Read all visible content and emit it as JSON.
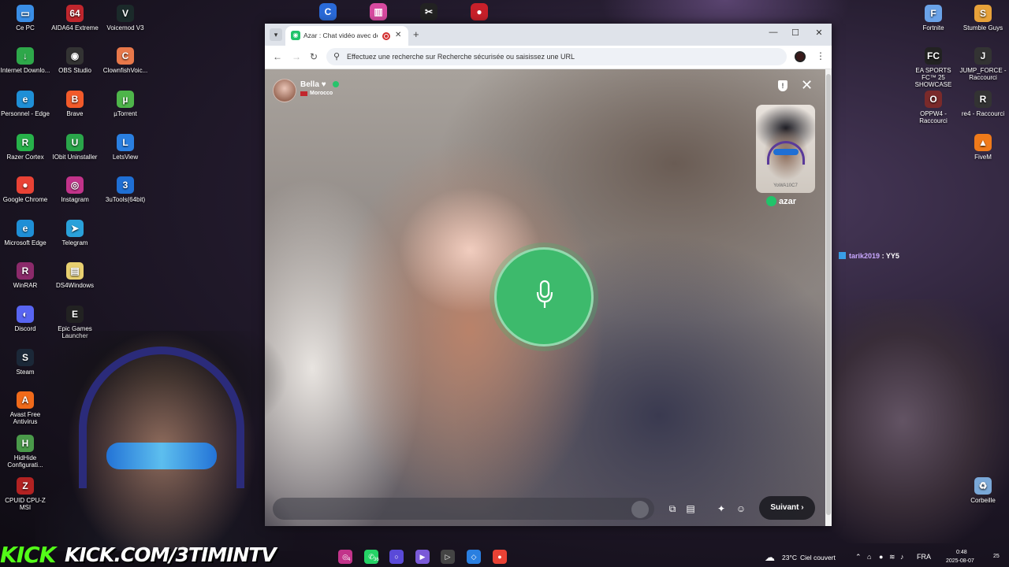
{
  "desktop_left": [
    {
      "label": "Ce PC",
      "icon": "computer-icon",
      "color": "#3a8ee6",
      "glyph": "▭"
    },
    {
      "label": "AIDA64 Extreme",
      "icon": "aida64-icon",
      "color": "#c0262d",
      "glyph": "64"
    },
    {
      "label": "Voicemod V3",
      "icon": "voicemod-icon",
      "color": "#1b2a2a",
      "glyph": "V"
    },
    {
      "label": "Internet Downlo...",
      "icon": "idm-icon",
      "color": "#2ea84a",
      "glyph": "↓"
    },
    {
      "label": "OBS Studio",
      "icon": "obs-icon",
      "color": "#333",
      "glyph": "◉"
    },
    {
      "label": "ClownfishVoic...",
      "icon": "clownfish-icon",
      "color": "#e8784a",
      "glyph": "C"
    },
    {
      "label": "Personnel - Edge",
      "icon": "edge-icon",
      "color": "#1f8fd6",
      "glyph": "e"
    },
    {
      "label": "Brave",
      "icon": "brave-icon",
      "color": "#f25a2a",
      "glyph": "B"
    },
    {
      "label": "µTorrent",
      "icon": "utorrent-icon",
      "color": "#4eb54a",
      "glyph": "µ"
    },
    {
      "label": "Razer Cortex",
      "icon": "razer-icon",
      "color": "#27b24a",
      "glyph": "R"
    },
    {
      "label": "IObit Uninstaller",
      "icon": "iobit-icon",
      "color": "#2aa64a",
      "glyph": "U"
    },
    {
      "label": "LetsView",
      "icon": "letsview-icon",
      "color": "#2a7fe0",
      "glyph": "L"
    },
    {
      "label": "Google Chrome",
      "icon": "chrome-icon",
      "color": "#e94235",
      "glyph": "●"
    },
    {
      "label": "Instagram",
      "icon": "instagram-icon",
      "color": "#c2338a",
      "glyph": "◎"
    },
    {
      "label": "3uTools(64bit)",
      "icon": "3utools-icon",
      "color": "#1f6fd4",
      "glyph": "3"
    },
    {
      "label": "Microsoft Edge",
      "icon": "edge-icon",
      "color": "#1f8fd6",
      "glyph": "e"
    },
    {
      "label": "Telegram",
      "icon": "telegram-icon",
      "color": "#2aa1da",
      "glyph": "➤"
    },
    {
      "label": "WinRAR",
      "icon": "winrar-icon",
      "color": "#8b2a6a",
      "glyph": "R"
    },
    {
      "label": "DS4Windows",
      "icon": "ds4windows-icon",
      "color": "#e8d070",
      "glyph": "▤"
    },
    {
      "label": "Discord",
      "icon": "discord-icon",
      "color": "#5865f2",
      "glyph": "◐"
    },
    {
      "label": "Epic Games Launcher",
      "icon": "epic-icon",
      "color": "#222",
      "glyph": "E"
    },
    {
      "label": "Steam",
      "icon": "steam-icon",
      "color": "#1b2838",
      "glyph": "S"
    },
    {
      "label": "Avast Free Antivirus",
      "icon": "avast-icon",
      "color": "#f06a1a",
      "glyph": "A"
    },
    {
      "label": "HidHide Configurati...",
      "icon": "hidhide-icon",
      "color": "#4a9a4a",
      "glyph": "H"
    },
    {
      "label": "CPUID CPU-Z MSI",
      "icon": "cpuz-icon",
      "color": "#b22222",
      "glyph": "Z"
    }
  ],
  "desktop_right": [
    {
      "label": "Fortnite",
      "icon": "fortnite-icon",
      "color": "#6aa2e8",
      "glyph": "F"
    },
    {
      "label": "Stumble Guys",
      "icon": "stumble-guys-icon",
      "color": "#e8a23a",
      "glyph": "S"
    },
    {
      "label": "EA SPORTS FC™ 25 SHOWCASE",
      "icon": "ea-fc-icon",
      "color": "#222",
      "glyph": "FC"
    },
    {
      "label": "JUMP_FORCE - Raccourci",
      "icon": "jumpforce-icon",
      "color": "#333",
      "glyph": "J"
    },
    {
      "label": "OPPW4 - Raccourci",
      "icon": "oppw4-icon",
      "color": "#7a2a2a",
      "glyph": "O"
    },
    {
      "label": "re4 - Raccourci",
      "icon": "re4-icon",
      "color": "#333",
      "glyph": "R"
    },
    {
      "label": "FiveM",
      "icon": "fivem-icon",
      "color": "#f07a1a",
      "glyph": "▲"
    },
    {
      "label": "Corbeille",
      "icon": "recycle-bin-icon",
      "color": "#7aa8d8",
      "glyph": "♻"
    }
  ],
  "top_pinned": [
    {
      "icon": "pinned-app-1-icon",
      "color": "#2a6ad8",
      "glyph": "C"
    },
    {
      "icon": "pinned-app-2-icon",
      "color": "#d84aa0",
      "glyph": "▥"
    },
    {
      "icon": "capcut-icon",
      "color": "#222",
      "glyph": "✂"
    },
    {
      "icon": "record-app-icon",
      "color": "#c8202a",
      "glyph": "●"
    }
  ],
  "browser": {
    "tab_title": "Azar : Chat vidéo avec de n",
    "tab_favicon": "azar-favicon-icon",
    "address_placeholder": "Effectuez une recherche sur Recherche sécurisée ou saisissez une URL",
    "window_min": "—",
    "window_max": "☐",
    "window_close": "✕"
  },
  "azar": {
    "peer_name": "Bella",
    "peer_heart": "♥",
    "peer_country": "Morocco",
    "self_label": "YoWA10C7",
    "logo": "azar",
    "next_label": "Suivant",
    "next_chevron": "›"
  },
  "stream_chat": {
    "user": "tarik2019",
    "message": ": YY5"
  },
  "branding": {
    "kick": "KICK",
    "url": "KICK.COM/3TIMINTV"
  },
  "taskbar": {
    "apps": [
      {
        "icon": "instagram-taskbar-icon",
        "color": "#c2338a",
        "glyph": "◎",
        "count": "4"
      },
      {
        "icon": "whatsapp-taskbar-icon",
        "color": "#25d366",
        "glyph": "✆",
        "count": "36"
      },
      {
        "icon": "cortana-taskbar-icon",
        "color": "#5a4ad8",
        "glyph": "○",
        "count": ""
      },
      {
        "icon": "gaming-taskbar-icon",
        "color": "#7a5ad8",
        "glyph": "▶",
        "count": ""
      },
      {
        "icon": "media-taskbar-icon",
        "color": "#444",
        "glyph": "▷",
        "count": ""
      },
      {
        "icon": "letsview-taskbar-icon",
        "color": "#2a7fe0",
        "glyph": "◇",
        "count": ""
      },
      {
        "icon": "chrome-taskbar-icon",
        "color": "#e94235",
        "glyph": "●",
        "count": ""
      }
    ],
    "weather_temp": "23°C",
    "weather_desc": "Ciel couvert",
    "lang": "FRA",
    "time": "0:48",
    "date": "2025-08-07",
    "notifications": "25"
  }
}
